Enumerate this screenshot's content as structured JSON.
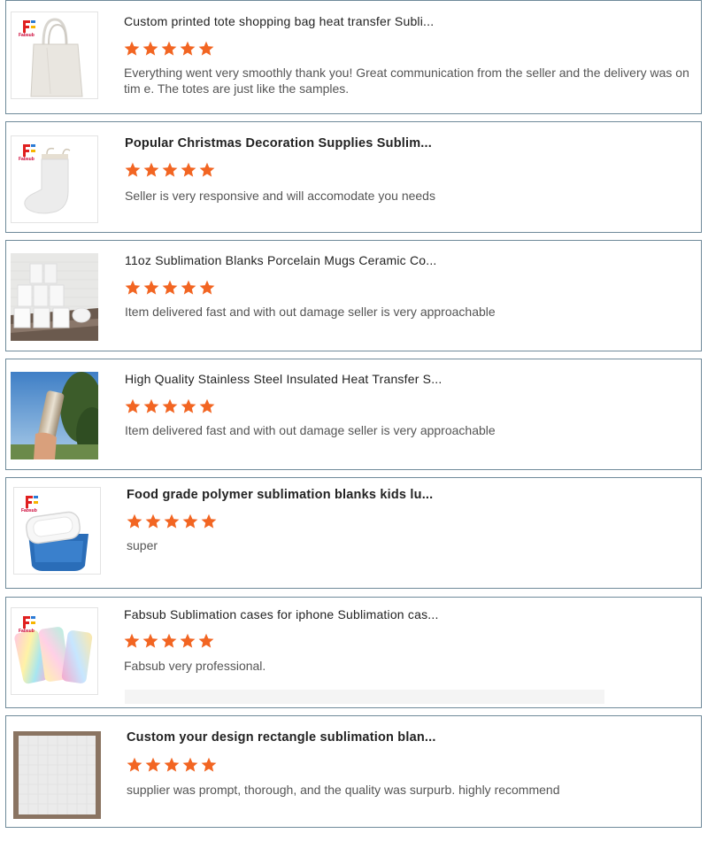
{
  "colors": {
    "star": "#f26522",
    "border": "#6f8a9a"
  },
  "logo_text": "Fabsub",
  "reviews": [
    {
      "title": "Custom printed tote shopping bag heat transfer Subli...",
      "rating": 5,
      "text": "Everything went very smoothly thank you! Great communication from the seller and the delivery was on tim e. The totes are just like the samples.",
      "image": "tote-bag-image"
    },
    {
      "title": "Popular Christmas Decoration Supplies Sublim...",
      "rating": 5,
      "text": "Seller is very responsive and will accomodate you needs",
      "image": "christmas-stocking-image"
    },
    {
      "title": "11oz Sublimation Blanks Porcelain Mugs Ceramic Co...",
      "rating": 5,
      "text": "Item delivered fast and with out damage seller is very approachable",
      "image": "mugs-image"
    },
    {
      "title": "High Quality Stainless Steel Insulated Heat Transfer S...",
      "rating": 5,
      "text": "Item delivered fast and with out damage seller is very approachable",
      "image": "tumbler-image"
    },
    {
      "title": "Food grade polymer sublimation blanks kids lu...",
      "rating": 5,
      "text": "super",
      "image": "lunchbox-image"
    },
    {
      "title": "Fabsub Sublimation cases for iphone Sublimation cas...",
      "rating": 5,
      "text": "Fabsub very professional.",
      "image": "phone-cases-image"
    },
    {
      "title": "Custom your design rectangle sublimation blan...",
      "rating": 5,
      "text": "supplier was prompt, thorough, and the quality was surpurb. highly recommend",
      "image": "puzzle-board-image"
    }
  ]
}
